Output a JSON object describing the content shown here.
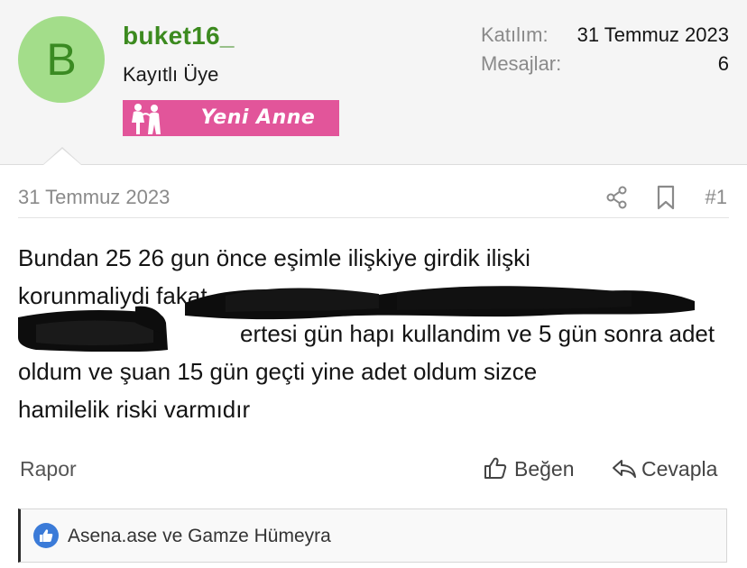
{
  "user": {
    "avatar_letter": "B",
    "username": "buket16_",
    "title": "Kayıtlı Üye",
    "rank_label": "Yeni Anne",
    "stats": [
      {
        "label": "Katılım:",
        "value": "31 Temmuz 2023"
      },
      {
        "label": "Mesajlar:",
        "value": "6"
      }
    ]
  },
  "post": {
    "date": "31 Temmuz 2023",
    "number": "#1",
    "body_lines": [
      "Bundan 25 26 gun önce eşimle ilişkiye girdik ilişki",
      "korunmaliydi fakat",
      "ertesi gün hapı kullandim ve 5 gün sonra adet",
      "oldum ve şuan 15 gün geçti yine adet oldum sizce",
      "hamilelik riski varmıdır"
    ]
  },
  "actions": {
    "report": "Rapor",
    "like": "Beğen",
    "reply": "Cevapla"
  },
  "reactions": {
    "text": "Asena.ase ve Gamze Hümeyra"
  },
  "colors": {
    "avatar_bg": "#a3dd8a",
    "username": "#3c8a1f",
    "rank_banner": "#e2559a",
    "reaction_like": "#3b7bd8"
  },
  "icons": [
    "share-icon",
    "bookmark-icon",
    "thumbs-up-icon",
    "reply-icon",
    "like-reaction-icon"
  ]
}
